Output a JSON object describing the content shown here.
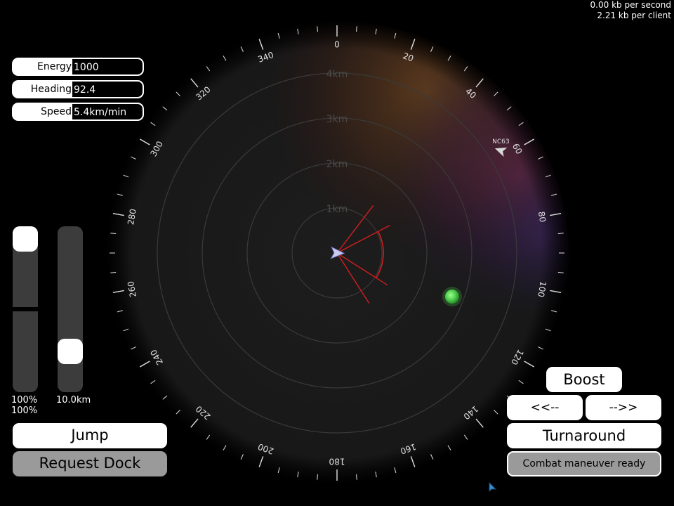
{
  "network": {
    "line1": "0.00 kb per second",
    "line2": "2.21 kb per client"
  },
  "stats": [
    {
      "label": "Energy",
      "value": "1000"
    },
    {
      "label": "Heading",
      "value": "92.4"
    },
    {
      "label": "Speed",
      "value": "5.4km/min"
    }
  ],
  "sliders": {
    "left_level": 1.0,
    "right_level": 0.2,
    "left_line1": "100%",
    "left_line2": "100%",
    "right_label": "10.0km"
  },
  "radar": {
    "ranges": [
      "1km",
      "2km",
      "3km",
      "4km"
    ],
    "compass_labels": [
      "0",
      "20",
      "40",
      "60",
      "80",
      "100",
      "120",
      "140",
      "160",
      "180",
      "200",
      "220",
      "240",
      "260",
      "280",
      "300",
      "320",
      "340"
    ],
    "contact": {
      "name": "NC63",
      "bearing_deg": 58,
      "distance_km": 4.3
    },
    "player_heading_deg": 92.4,
    "planet_color": "#4ccc4c",
    "weapon_arc_color": "#d21e1e"
  },
  "buttons": {
    "jump": "Jump",
    "request_dock": "Request Dock",
    "boost": "Boost",
    "turn_left": "<<--",
    "turn_right": "-->>",
    "turnaround": "Turnaround",
    "combat": "Combat maneuver ready"
  }
}
